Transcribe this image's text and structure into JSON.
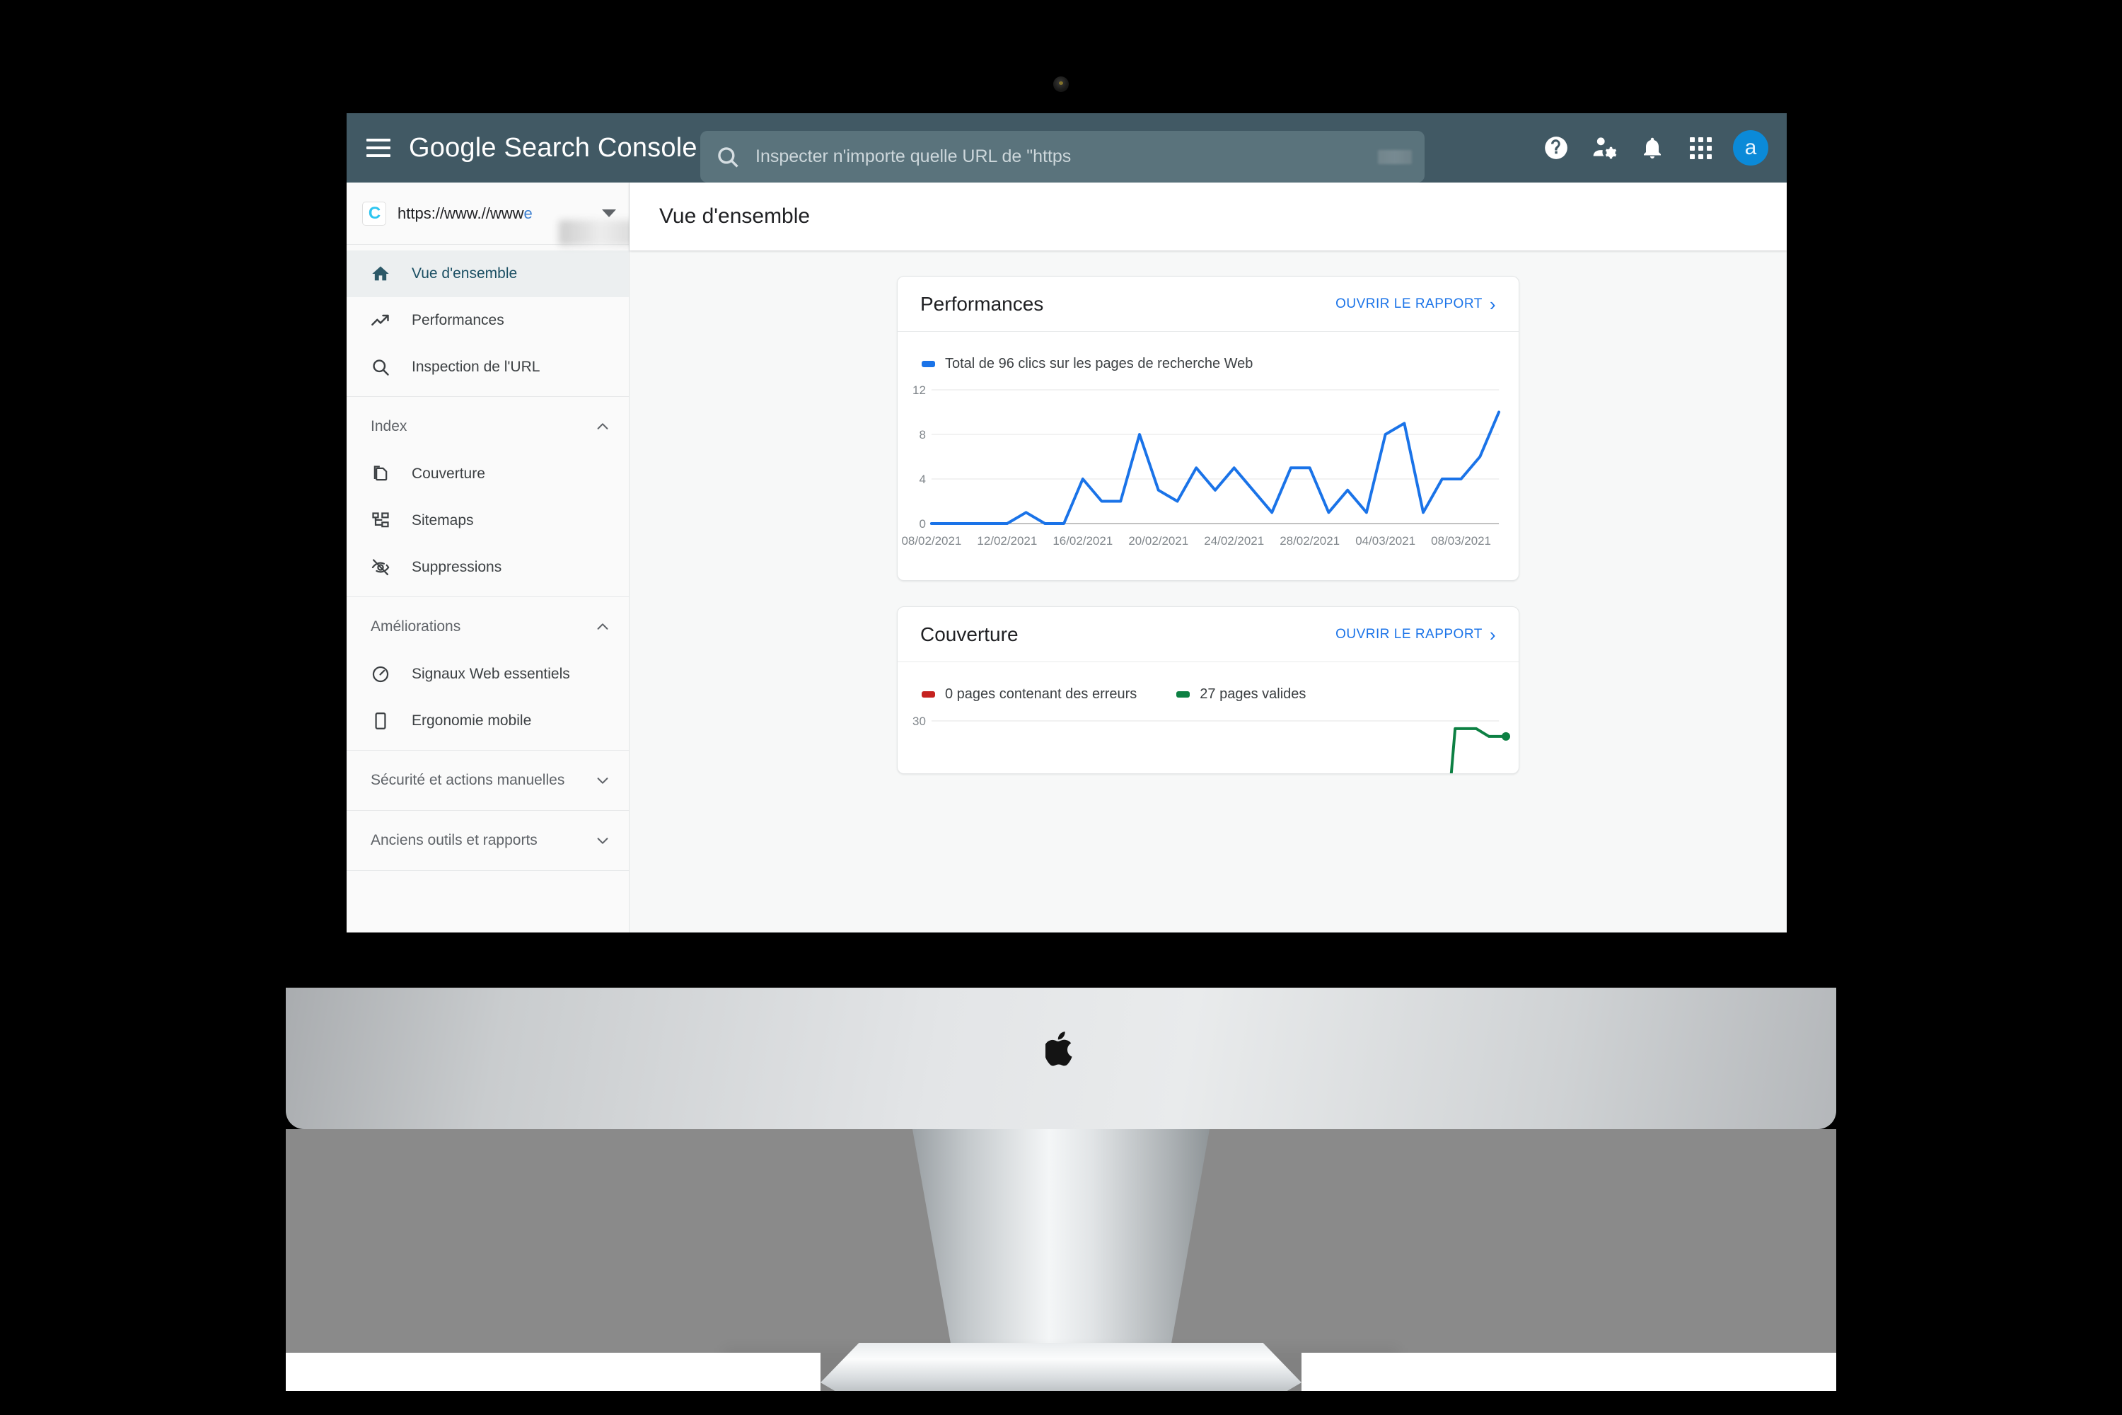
{
  "header": {
    "menu_label": "Menu",
    "brand_google": "Google",
    "brand_product": "Search Console",
    "search": {
      "placeholder": "Inspecter n'importe quelle URL de \"https",
      "value": ""
    },
    "icons": {
      "help": "help-icon",
      "account_settings": "account-settings-icon",
      "notifications": "bell-icon",
      "apps": "apps-grid-icon"
    },
    "avatar_initial": "a",
    "bar_color": "#415964",
    "accent_blue": "#1a73e8"
  },
  "sidebar": {
    "property": {
      "logo_letter": "C",
      "url_visible": "https://www.//www",
      "url_tail": "e",
      "dropdown": "chevron-down-icon"
    },
    "groups": [
      {
        "section": null,
        "items": [
          {
            "label": "Vue d'ensemble",
            "icon": "home-icon",
            "active": true
          },
          {
            "label": "Performances",
            "icon": "trending-up-icon",
            "active": false
          },
          {
            "label": "Inspection de l'URL",
            "icon": "search-icon",
            "active": false
          }
        ]
      },
      {
        "section": "Index",
        "expanded": true,
        "items": [
          {
            "label": "Couverture",
            "icon": "pages-icon",
            "active": false
          },
          {
            "label": "Sitemaps",
            "icon": "sitemap-icon",
            "active": false
          },
          {
            "label": "Suppressions",
            "icon": "eye-off-icon",
            "active": false
          }
        ]
      },
      {
        "section": "Améliorations",
        "expanded": true,
        "items": [
          {
            "label": "Signaux Web essentiels",
            "icon": "speedometer-icon",
            "active": false
          },
          {
            "label": "Ergonomie mobile",
            "icon": "mobile-icon",
            "active": false
          }
        ]
      },
      {
        "section": "Sécurité et actions manuelles",
        "expanded": false,
        "items": []
      },
      {
        "section": "Anciens outils et rapports",
        "expanded": false,
        "items": []
      }
    ]
  },
  "page": {
    "title": "Vue d'ensemble"
  },
  "cards": {
    "performances": {
      "title": "Performances",
      "link": "OUVRIR LE RAPPORT",
      "legend": [
        {
          "label": "Total de 96 clics sur les pages de recherche Web",
          "color": "#1a73e8"
        }
      ]
    },
    "couverture": {
      "title": "Couverture",
      "link": "OUVRIR LE RAPPORT",
      "legend": [
        {
          "label": "0 pages contenant des erreurs",
          "color": "#c5221f"
        },
        {
          "label": "27 pages valides",
          "color": "#0d8043"
        }
      ]
    }
  },
  "chart_data": [
    {
      "type": "line",
      "title": "Total de 96 clics sur les pages de recherche Web",
      "xlabel": "",
      "ylabel": "",
      "ylim": [
        0,
        12
      ],
      "yticks": [
        0,
        4,
        8,
        12
      ],
      "grid": true,
      "legend_position": "top-left",
      "color": "#1a73e8",
      "xtick_labels": [
        "08/02/2021",
        "12/02/2021",
        "16/02/2021",
        "20/02/2021",
        "24/02/2021",
        "28/02/2021",
        "04/03/2021",
        "08/03/2021"
      ],
      "x": [
        "08/02/2021",
        "09/02/2021",
        "10/02/2021",
        "11/02/2021",
        "12/02/2021",
        "13/02/2021",
        "14/02/2021",
        "15/02/2021",
        "16/02/2021",
        "17/02/2021",
        "18/02/2021",
        "19/02/2021",
        "20/02/2021",
        "21/02/2021",
        "22/02/2021",
        "23/02/2021",
        "24/02/2021",
        "25/02/2021",
        "26/02/2021",
        "27/02/2021",
        "28/02/2021",
        "01/03/2021",
        "02/03/2021",
        "03/03/2021",
        "04/03/2021",
        "05/03/2021",
        "06/03/2021",
        "07/03/2021",
        "08/03/2021",
        "09/03/2021"
      ],
      "values": [
        0,
        0,
        0,
        0,
        0,
        1,
        0,
        0,
        4,
        2,
        2,
        8,
        3,
        2,
        5,
        3,
        5,
        3,
        1,
        5,
        5,
        1,
        3,
        1,
        8,
        9,
        1,
        4,
        4,
        6,
        10
      ]
    },
    {
      "type": "line",
      "title": "Couverture",
      "ylim": [
        0,
        30
      ],
      "yticks": [
        30
      ],
      "grid": true,
      "legend_position": "top-left",
      "series": [
        {
          "name": "0 pages contenant des erreurs",
          "color": "#c5221f",
          "values": []
        },
        {
          "name": "27 pages valides",
          "color": "#0d8043",
          "values": [
            0,
            0,
            0,
            28,
            28,
            27,
            27
          ]
        }
      ]
    }
  ]
}
